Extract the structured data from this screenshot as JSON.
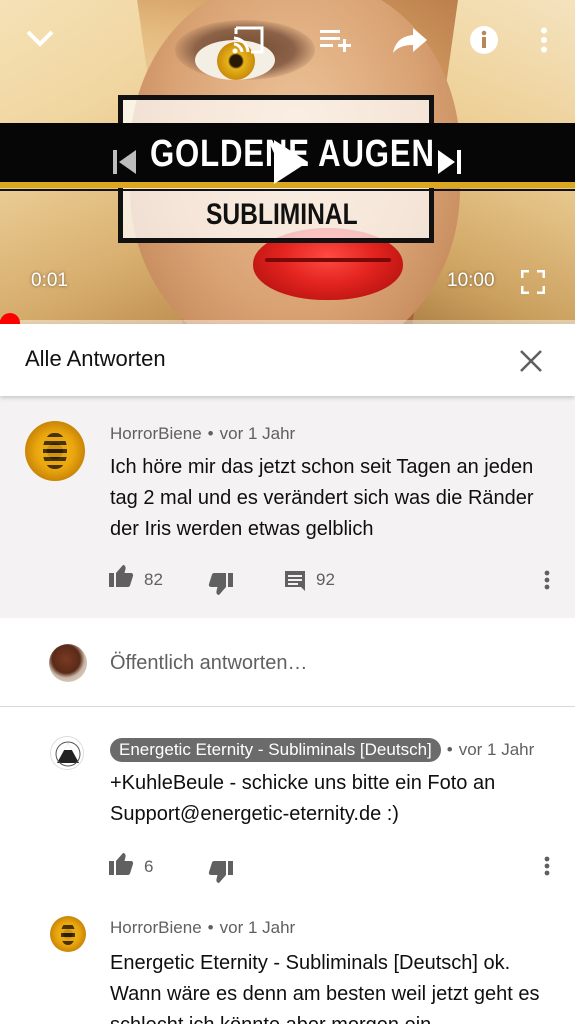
{
  "player": {
    "video_title_graphic": "GOLDENE AUGEN",
    "video_subtitle_graphic": "SUBLIMINAL",
    "current_time": "0:01",
    "duration": "10:00",
    "progress_fraction": 0.0017,
    "icons": {
      "minimize": "chevron-down-icon",
      "cast": "cast-icon",
      "add_to_queue": "add-to-queue-icon",
      "share": "share-icon",
      "info": "info-icon",
      "more": "more-vert-icon",
      "previous": "skip-previous-icon",
      "play": "play-icon",
      "next": "skip-next-icon",
      "fullscreen": "fullscreen-icon"
    }
  },
  "replies_panel": {
    "title": "Alle Antworten",
    "close_icon": "close-icon"
  },
  "original_comment": {
    "author": "HorrorBiene",
    "separator": "•",
    "age": "vor 1 Jahr",
    "text": "Ich höre mir das jetzt schon seit Tagen an jeden tag 2 mal und es verändert sich was die Ränder der Iris werden etwas gelblich",
    "likes": "82",
    "replies": "92"
  },
  "reply_box": {
    "placeholder": "Öffentlich antworten…"
  },
  "replies": [
    {
      "author": "Energetic Eternity - Subliminals [Deutsch]",
      "separator": "•",
      "age": "vor 1 Jahr",
      "text": "+KuhleBeule - schicke uns bitte ein Foto an Support@energetic-eternity.de :)",
      "likes": "6"
    },
    {
      "author": "HorrorBiene",
      "separator": "•",
      "age": "vor 1 Jahr",
      "text": "Energetic Eternity - Subliminals [Deutsch] ok. Wann wäre es denn am besten weil jetzt geht es schlecht ich könnte aber morgen ein"
    }
  ],
  "colors": {
    "progress": "#ff0000",
    "comment_bg": "#f4f2f2",
    "owner_chip": "#6b6b6b",
    "banner_gold": "#d9a820"
  }
}
